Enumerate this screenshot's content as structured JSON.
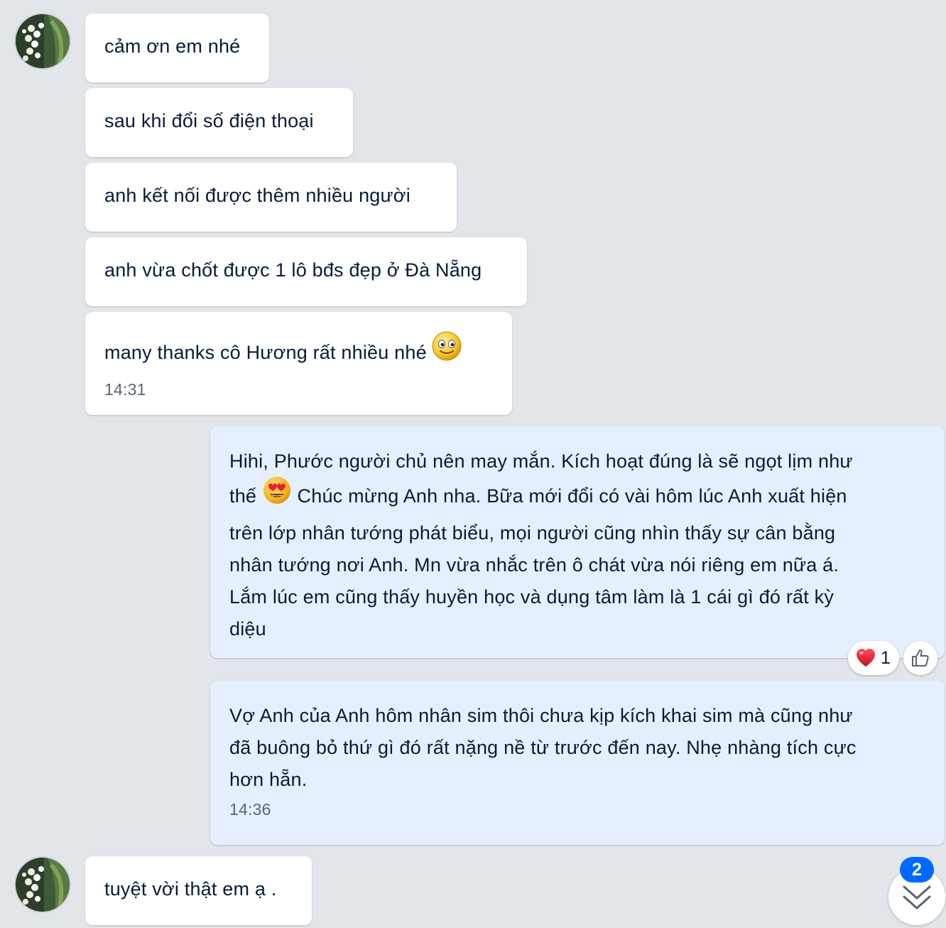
{
  "conversation": {
    "incoming_group_1": [
      {
        "text": "cảm ơn em nhé"
      },
      {
        "text": "sau khi đổi số điện thoại"
      },
      {
        "text": "anh kết nối được thêm nhiều người"
      },
      {
        "text": "anh vừa chốt được 1 lô bđs đẹp ở Đà Nẵng"
      },
      {
        "text": "many thanks cô Hương rất nhiều nhé",
        "emoji": "smiling-face-emoji",
        "time": "14:31"
      }
    ],
    "outgoing_1": {
      "line1": "Hihi, Phước người chủ nên may mắn. Kích hoạt đúng là sẽ ngọt lịm như",
      "line2_a": "thế",
      "line2_emoji": "heart-eyes-emoji",
      "line2_b": "Chúc mừng Anh nha. Bữa mới đổi có vài hôm lúc Anh xuất hiện",
      "line3": "trên lớp nhân tướng phát biểu, mọi người cũng nhìn thấy sự cân bằng",
      "line4": "nhân tướng nơi Anh. Mn vừa nhắc trên ô chát vừa nói riêng em nữa á.",
      "line5": "Lắm lúc em cũng thấy huyền học và dụng tâm làm là 1 cái gì đó rất kỳ",
      "line6": "diệu",
      "reaction_icon": "heart-icon",
      "reaction_count": "1"
    },
    "outgoing_2": {
      "line1": "Vợ Anh của Anh hôm nhân sim thôi chưa kịp kích khai sim mà cũng như",
      "line2": "đã buông bỏ thứ gì đó rất nặng nề từ trước đến nay. Nhẹ nhàng tích cực",
      "line3": "hơn hẵn.",
      "time": "14:36"
    },
    "incoming_group_2": [
      {
        "text": "tuyệt vời thật em ạ ."
      }
    ]
  },
  "scroll_button": {
    "icon": "double-chevron-down-icon",
    "unread_count": "2"
  },
  "colors": {
    "background": "#e2e5e9",
    "incoming_bubble": "#ffffff",
    "outgoing_bubble": "#e5efff",
    "text": "#081b3a",
    "timestamp": "#5a6572",
    "badge": "#0068ff"
  }
}
